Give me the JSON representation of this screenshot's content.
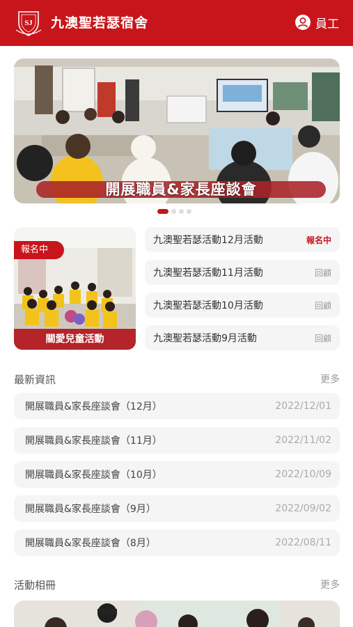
{
  "header": {
    "logo_text": "SJ",
    "title": "九澳聖若瑟宿舍",
    "staff_label": "員工"
  },
  "banner": {
    "caption": "開展職員&家長座談會",
    "page_count": 4,
    "active_index": 0
  },
  "featured": {
    "badge": "報名中",
    "caption": "關愛兒童活動"
  },
  "events": [
    {
      "title": "九澳聖若瑟活動12月活動",
      "tag": "報名中",
      "status": "open"
    },
    {
      "title": "九澳聖若瑟活動11月活動",
      "tag": "回顧",
      "status": "review"
    },
    {
      "title": "九澳聖若瑟活動10月活動",
      "tag": "回顧",
      "status": "review"
    },
    {
      "title": "九澳聖若瑟活動9月活動",
      "tag": "回顧",
      "status": "review"
    }
  ],
  "news": {
    "title": "最新資訊",
    "more": "更多",
    "items": [
      {
        "title": "開展職員&家長座談會（12月）",
        "date": "2022/12/01"
      },
      {
        "title": "開展職員&家長座談會（11月）",
        "date": "2022/11/02"
      },
      {
        "title": "開展職員&家長座談會（10月）",
        "date": "2022/10/09"
      },
      {
        "title": "開展職員&家長座談會（9月）",
        "date": "2022/09/02"
      },
      {
        "title": "開展職員&家長座談會（8月）",
        "date": "2022/08/11"
      }
    ]
  },
  "album": {
    "title": "活動相冊",
    "more": "更多"
  },
  "colors": {
    "brand": "#c8151b",
    "card_bg": "#f5f5f5",
    "muted": "#999999"
  }
}
